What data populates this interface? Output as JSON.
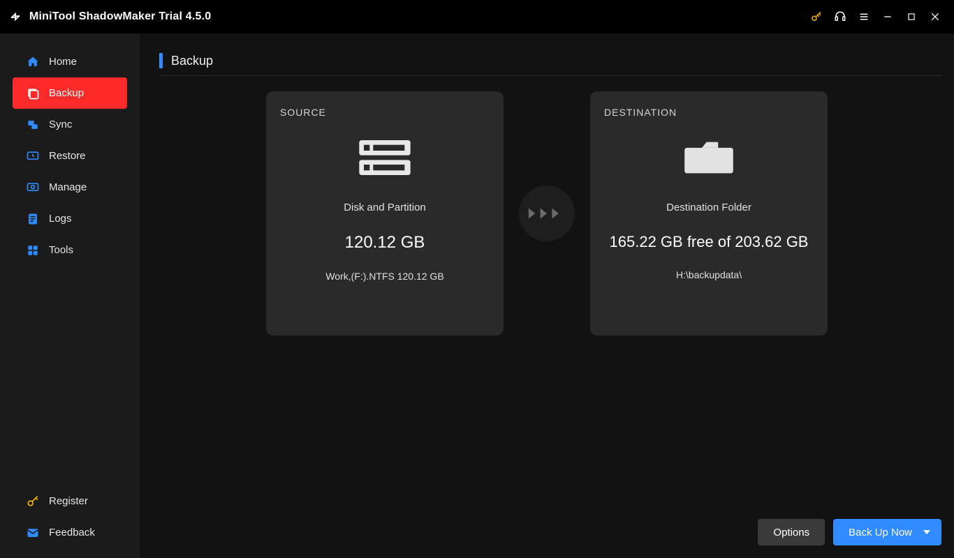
{
  "titlebar": {
    "app_title": "MiniTool ShadowMaker Trial 4.5.0"
  },
  "sidebar": {
    "items": [
      {
        "label": "Home"
      },
      {
        "label": "Backup"
      },
      {
        "label": "Sync"
      },
      {
        "label": "Restore"
      },
      {
        "label": "Manage"
      },
      {
        "label": "Logs"
      },
      {
        "label": "Tools"
      }
    ],
    "bottom": [
      {
        "label": "Register"
      },
      {
        "label": "Feedback"
      }
    ]
  },
  "page": {
    "title": "Backup"
  },
  "source": {
    "heading": "SOURCE",
    "type_label": "Disk and Partition",
    "size": "120.12 GB",
    "detail": "Work,(F:).NTFS 120.12 GB"
  },
  "destination": {
    "heading": "DESTINATION",
    "type_label": "Destination Folder",
    "free_line": "165.22 GB free of 203.62 GB",
    "path": "H:\\backupdata\\"
  },
  "footer": {
    "options": "Options",
    "backup_now": "Back Up Now"
  }
}
